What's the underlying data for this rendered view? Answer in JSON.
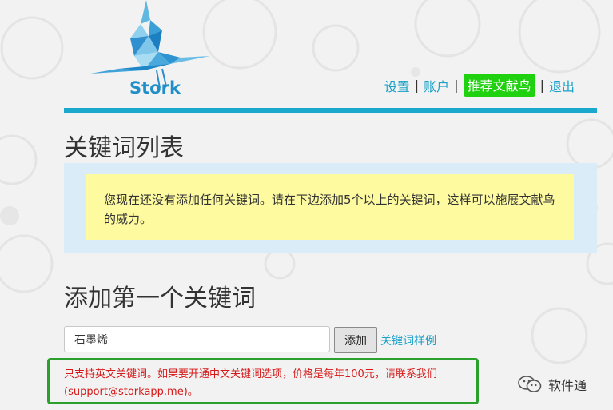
{
  "brand": {
    "name": "Stork",
    "logo_icon": "stork-bird-logo",
    "brand_color": "#1f8fc9"
  },
  "nav": {
    "items": [
      {
        "label": "设置",
        "highlight": false
      },
      {
        "label": "账户",
        "highlight": false
      },
      {
        "label": "推荐文献鸟",
        "highlight": true
      },
      {
        "label": "退出",
        "highlight": false
      }
    ],
    "separator": "|",
    "link_color": "#1ba1c7",
    "highlight_color": "#1fd10f"
  },
  "keyword_list": {
    "title": "关键词列表",
    "notice": "您现在还没有添加任何关键词。请在下边添加5个以上的关键词，这样可以施展文献鸟的威力。"
  },
  "add_keyword": {
    "title": "添加第一个关键词",
    "input_value": "石墨烯",
    "add_button_label": "添加",
    "example_link_label": "关键词样例",
    "warning": "只支持英文关键词。如果要开通中文关键词选项，价格是每年100元，请联系我们(support@storkapp.me)。",
    "warning_color": "#d61a1a"
  },
  "watermark": {
    "icon": "wechat-icon",
    "text": "软件通"
  }
}
